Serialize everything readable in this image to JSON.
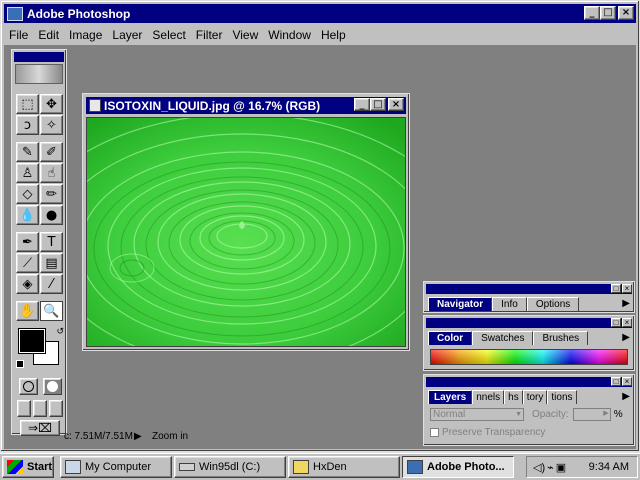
{
  "app": {
    "title": "Adobe Photoshop",
    "menu": [
      "File",
      "Edit",
      "Image",
      "Layer",
      "Select",
      "Filter",
      "View",
      "Window",
      "Help"
    ]
  },
  "document": {
    "title": "ISOTOXIN_LIQUID.jpg @ 16.7% (RGB)"
  },
  "status": {
    "doc_size": "c: 7.51M/7.51M",
    "tool_hint": "Zoom in"
  },
  "toolbox": {
    "tools": [
      {
        "icon": "rect-marquee-icon",
        "glyph": "⬚"
      },
      {
        "icon": "move-icon",
        "glyph": "✥"
      },
      {
        "icon": "lasso-icon",
        "glyph": "ↄ"
      },
      {
        "icon": "magic-wand-icon",
        "glyph": "✧"
      },
      {
        "icon": "airbrush-icon",
        "glyph": "✎"
      },
      {
        "icon": "paintbrush-icon",
        "glyph": "✐"
      },
      {
        "icon": "rubber-stamp-icon",
        "glyph": "♙"
      },
      {
        "icon": "smudge-icon",
        "glyph": "☝"
      },
      {
        "icon": "eraser-icon",
        "glyph": "◇"
      },
      {
        "icon": "pencil-icon",
        "glyph": "✏"
      },
      {
        "icon": "blur-icon",
        "glyph": "💧"
      },
      {
        "icon": "dodge-icon",
        "glyph": "●"
      },
      {
        "icon": "pen-icon",
        "glyph": "✒"
      },
      {
        "icon": "type-icon",
        "glyph": "T"
      },
      {
        "icon": "line-icon",
        "glyph": "⟋"
      },
      {
        "icon": "gradient-icon",
        "glyph": "▤"
      },
      {
        "icon": "paint-bucket-icon",
        "glyph": "◈"
      },
      {
        "icon": "eyedropper-icon",
        "glyph": "⁄"
      },
      {
        "icon": "hand-icon",
        "glyph": "✋"
      },
      {
        "icon": "zoom-icon",
        "glyph": "🔍"
      }
    ],
    "foreground_color": "#000000",
    "background_color": "#ffffff"
  },
  "palettes": {
    "navigator": {
      "tabs": [
        "Navigator",
        "Info",
        "Options"
      ],
      "active": 0
    },
    "color": {
      "tabs": [
        "Color",
        "Swatches",
        "Brushes"
      ],
      "active": 0
    },
    "layers": {
      "tabs": [
        "Layers",
        "nnels",
        "hs",
        "tory",
        "tions"
      ],
      "active": 0,
      "blend_mode": "Normal",
      "opacity_label": "Opacity:",
      "opacity_unit": "%",
      "preserve_label": "Preserve Transparency"
    }
  },
  "taskbar": {
    "start": "Start",
    "tasks": [
      "My Computer",
      "Win95dl (C:)",
      "HxDen",
      "Adobe Photo..."
    ],
    "active_task": 3,
    "clock": "9:34 AM"
  },
  "colors": {
    "titlebar": "#000080",
    "face": "#c0c0c0",
    "workspace": "#808080",
    "liquid_green": "#3fd23f"
  }
}
